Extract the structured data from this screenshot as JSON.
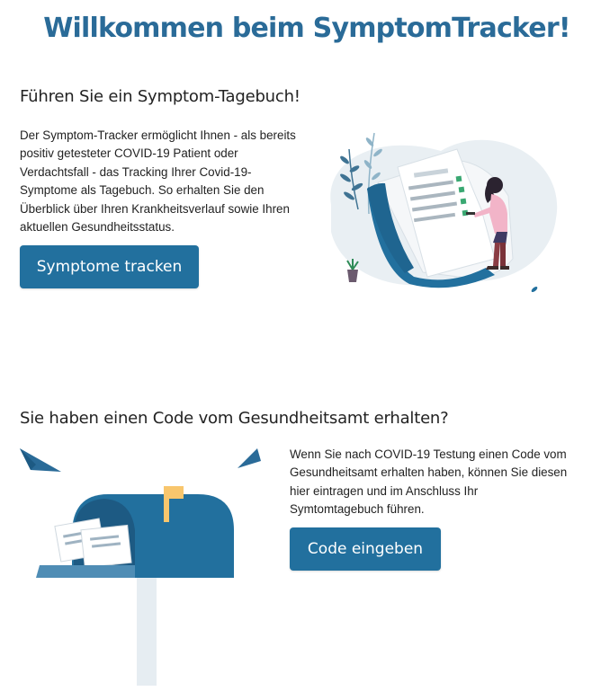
{
  "page": {
    "title": "Willkommen beim SymptomTracker!"
  },
  "diary_section": {
    "heading": "Führen Sie ein Symptom-Tagebuch!",
    "text": "Der Symptom-Tracker ermöglicht Ihnen - als bereits positiv getesteter COVID-19 Patient oder Verdachtsfall - das Tracking Ihrer Covid-19-Symptome als Tagebuch. So erhalten Sie den Überblick über Ihren Krankheitsverlauf sowie Ihren aktuellen Gesundheitsstatus.",
    "button_label": "Symptome tracken"
  },
  "code_section": {
    "heading": "Sie haben einen Code vom Gesundheitsamt erhalten?",
    "text": "Wenn Sie nach COVID-19 Testung einen Code vom Gesundheitsamt erhalten haben, können Sie diesen hier eintragen und im Anschluss Ihr Symtomtagebuch führen.",
    "button_label": "Code eingeben"
  },
  "colors": {
    "brand_blue": "#22709e",
    "title_blue": "#2a6b98",
    "illustration_bg": "#e9eff3",
    "flag_yellow": "#f8c66d",
    "accent_pink": "#f2b4c8"
  },
  "illustrations": {
    "diary": "person-checking-list-illustration",
    "mailbox": "mailbox-with-letters-illustration"
  }
}
